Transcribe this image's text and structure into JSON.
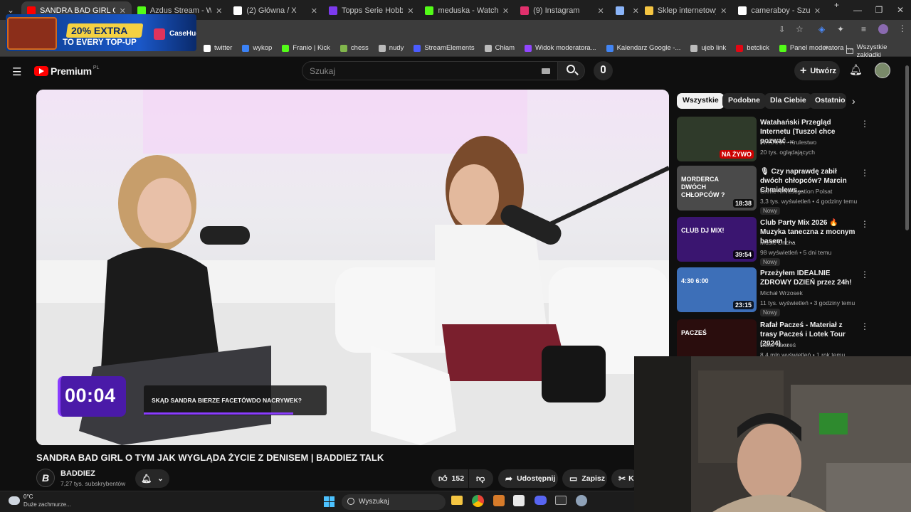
{
  "browser": {
    "tabs": [
      {
        "title": "SANDRA BAD GIRL O TYM",
        "color": "#ff0000",
        "active": true
      },
      {
        "title": "Azdus Stream - Watch Liv",
        "color": "#53fc18",
        "active": false
      },
      {
        "title": "(2) Główna / X",
        "color": "#ffffff",
        "active": false
      },
      {
        "title": "Topps Serie Hobby Boxy I",
        "color": "#7c3aed",
        "active": false
      },
      {
        "title": "meduska - Watch clips on",
        "color": "#53fc18",
        "active": false
      },
      {
        "title": "(9) Instagram",
        "color": "#e1306c",
        "active": false
      },
      {
        "title": "",
        "color": "#8ab4f8",
        "active": false
      },
      {
        "title": "Sklep internetowy True C",
        "color": "#f5c542",
        "active": false
      },
      {
        "title": "cameraboy - Szukaj w Go",
        "color": "#ffffff",
        "active": false
      }
    ],
    "bookmarks": [
      {
        "label": "twitter",
        "color": "#ffffff"
      },
      {
        "label": "wykop",
        "color": "#3b82f6"
      },
      {
        "label": "Franio | Kick",
        "color": "#53fc18"
      },
      {
        "label": "chess",
        "color": "#81b64c"
      },
      {
        "label": "nudy",
        "color": "#bbbbbb"
      },
      {
        "label": "StreamElements",
        "color": "#4b5cff"
      },
      {
        "label": "Chłam",
        "color": "#bbbbbb"
      },
      {
        "label": "Widok moderatora...",
        "color": "#9146ff"
      },
      {
        "label": "Kalendarz Google -...",
        "color": "#4285f4"
      },
      {
        "label": "ujeb link",
        "color": "#bbbbbb"
      },
      {
        "label": "betclick",
        "color": "#e30613"
      },
      {
        "label": "Panel moderatora |...",
        "color": "#53fc18"
      }
    ],
    "all_bookmarks": "Wszystkie zakładki"
  },
  "ad": {
    "headline": "20% EXTRA",
    "subline": "TO EVERY TOP-UP",
    "brand": "CaseHug"
  },
  "youtube": {
    "logo_text": "Premium",
    "logo_region": "PL",
    "search_placeholder": "Szukaj",
    "create_label": "Utwórz",
    "chips": [
      "Wszystkie",
      "Podobne",
      "Dla Ciebie",
      "Ostatnio"
    ],
    "video": {
      "timer": "00:04",
      "caption": "SKĄD SANDRA BIERZE FACETÓWDO NACRYWEK?",
      "title": "SANDRA BAD GIRL O TYM JAK WYGLĄDA ŻYCIE Z DENISEM | BADDIEZ TALK",
      "channel": "BADDIEZ",
      "subscribers": "7,27 tys. subskrybentów",
      "likes": "152",
      "share_label": "Udostępnij",
      "save_label": "Zapisz",
      "clip_label": "K"
    },
    "recommendations": [
      {
        "title": "Watahański Przegląd Internetu (Tuszol chce pozwać ...",
        "channel": "WATAHA - Krulestwo",
        "meta": "20 tys. oglądających",
        "badge": "NA ŻYWO",
        "new": "",
        "thumb": "#2f3a2a"
      },
      {
        "title": "🎙 Czy naprawdę zabił dwóch chłopców? Marcin Chmielews...",
        "channel": "Crime+Investigation Polsat",
        "meta": "3,3 tys. wyświetleń • 4 godziny temu",
        "badge": "18:38",
        "new": "Nowy",
        "thumb": "#4a4a4a",
        "thumb_text": "MORDERCA DWÓCH CHŁOPCÓW ?"
      },
      {
        "title": "Club Party Mix 2026 🔥 Muzyka taneczna z mocnym basem | ...",
        "channel": "Music Oncha",
        "meta": "98 wyświetleń • 5 dni temu",
        "badge": "39:54",
        "new": "Nowy",
        "thumb": "#3a1570",
        "thumb_text": "CLUB DJ MIX!"
      },
      {
        "title": "Przeżyłem IDEALNIE ZDROWY DZIEŃ przez 24h!",
        "channel": "Michał Wrzosek",
        "meta": "11 tys. wyświetleń • 3 godziny temu",
        "badge": "23:15",
        "new": "Nowy",
        "thumb": "#3d6fb8",
        "thumb_text": "4:30   6:00"
      },
      {
        "title": "Rafał Pacześ - Materiał z trasy Pacześ i Lotek Tour (2024) ...",
        "channel": "Rafał Pacześ",
        "meta": "8,4 mln wyświetleń • 1 rok temu",
        "badge": "",
        "new": "",
        "thumb": "#2a0d0d",
        "thumb_text": "PACZEŚ"
      }
    ]
  },
  "taskbar": {
    "weather_temp": "0°C",
    "weather_desc": "Duże zachmurze...",
    "search": "Wyszukaj"
  }
}
